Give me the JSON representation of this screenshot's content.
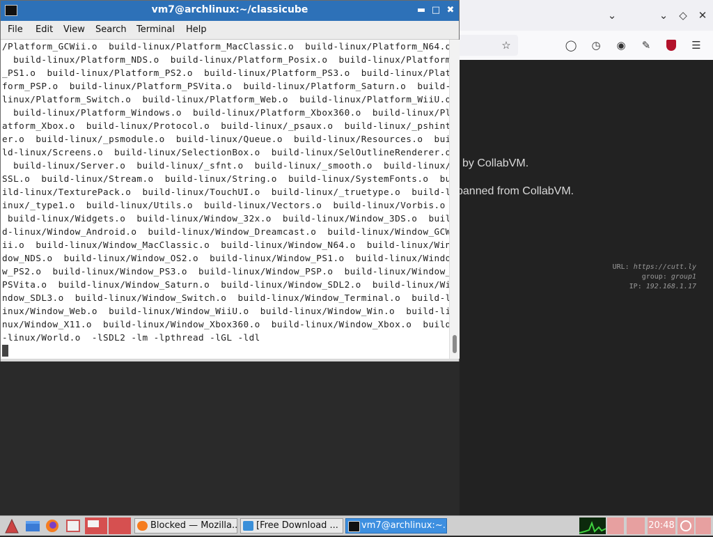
{
  "terminal": {
    "title": "vm7@archlinux:~/classicube",
    "menu": [
      "File",
      "Edit",
      "View",
      "Search",
      "Terminal",
      "Help"
    ],
    "lines": [
      "/Platform_GCWii.o  build-linux/Platform_MacClassic.o  build-linux/Platform_N64.o",
      "  build-linux/Platform_NDS.o  build-linux/Platform_Posix.o  build-linux/Platform",
      "_PS1.o  build-linux/Platform_PS2.o  build-linux/Platform_PS3.o  build-linux/Plat",
      "form_PSP.o  build-linux/Platform_PSVita.o  build-linux/Platform_Saturn.o  build-",
      "linux/Platform_Switch.o  build-linux/Platform_Web.o  build-linux/Platform_WiiU.o",
      "  build-linux/Platform_Windows.o  build-linux/Platform_Xbox360.o  build-linux/Pl",
      "atform_Xbox.o  build-linux/Protocol.o  build-linux/_psaux.o  build-linux/_pshint",
      "er.o  build-linux/_psmodule.o  build-linux/Queue.o  build-linux/Resources.o  bui",
      "ld-linux/Screens.o  build-linux/SelectionBox.o  build-linux/SelOutlineRenderer.o",
      "  build-linux/Server.o  build-linux/_sfnt.o  build-linux/_smooth.o  build-linux/",
      "SSL.o  build-linux/Stream.o  build-linux/String.o  build-linux/SystemFonts.o  bu",
      "ild-linux/TexturePack.o  build-linux/TouchUI.o  build-linux/_truetype.o  build-l",
      "inux/_type1.o  build-linux/Utils.o  build-linux/Vectors.o  build-linux/Vorbis.o ",
      " build-linux/Widgets.o  build-linux/Window_32x.o  build-linux/Window_3DS.o  buil",
      "d-linux/Window_Android.o  build-linux/Window_Dreamcast.o  build-linux/Window_GCW",
      "ii.o  build-linux/Window_MacClassic.o  build-linux/Window_N64.o  build-linux/Win",
      "dow_NDS.o  build-linux/Window_OS2.o  build-linux/Window_PS1.o  build-linux/Windo",
      "w_PS2.o  build-linux/Window_PS3.o  build-linux/Window_PSP.o  build-linux/Window_",
      "PSVita.o  build-linux/Window_Saturn.o  build-linux/Window_SDL2.o  build-linux/Wi",
      "ndow_SDL3.o  build-linux/Window_Switch.o  build-linux/Window_Terminal.o  build-l",
      "inux/Window_Web.o  build-linux/Window_WiiU.o  build-linux/Window_Win.o  build-li",
      "nux/Window_X11.o  build-linux/Window_Xbox360.o  build-linux/Window_Xbox.o  build",
      "-linux/World.o  -lSDL2 -lm -lpthread -lGL -ldl"
    ]
  },
  "browser": {
    "page_msg_1": "l by CollabVM.",
    "page_msg_2": " banned from CollabVM.",
    "info": {
      "url_label": "URL:",
      "url_value": "https://cutt.ly",
      "group_label": "group:",
      "group_value": "group1",
      "ip_label": "IP:",
      "ip_value": "192.168.1.17"
    }
  },
  "taskbar": {
    "tasks": [
      {
        "label": "Blocked — Mozilla...",
        "active": false
      },
      {
        "label": "[Free Download ...",
        "active": false
      },
      {
        "label": "vm7@archlinux:~...",
        "active": true
      }
    ],
    "clock": "20:48"
  },
  "colors": {
    "titlebar": "#2d71b8",
    "task_active": "#3d8fe0"
  }
}
